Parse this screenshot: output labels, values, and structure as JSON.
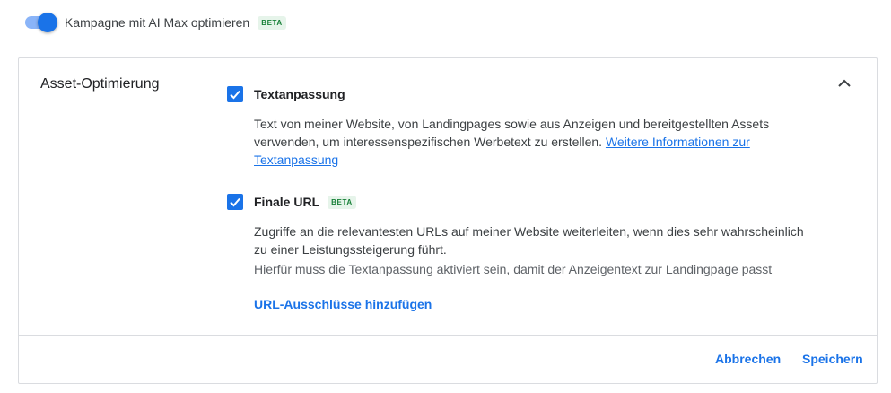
{
  "toggle": {
    "label": "Kampagne mit AI Max optimieren",
    "badge": "BETA",
    "on": true,
    "color": "#1a73e8"
  },
  "card": {
    "title": "Asset-Optimierung",
    "collapse_icon": "chevron-up-icon"
  },
  "options": {
    "text": {
      "title": "Textanpassung",
      "checked": true,
      "desc_line1": "Text von meiner Website, von Landingpages sowie aus Anzeigen und bereitgestellten Assets",
      "desc_line2": "verwenden, um interessenspezifischen Werbetext zu erstellen.",
      "link_line1": "Weitere Informationen zur",
      "link_line2": "Textanpassung"
    },
    "url": {
      "title": "Finale URL",
      "badge": "BETA",
      "checked": true,
      "desc_line1": "Zugriffe an die relevantesten URLs auf meiner Website weiterleiten, wenn dies sehr wahrscheinlich",
      "desc_line2": "zu einer Leistungssteigerung führt.",
      "note": "Hierfür muss die Textanpassung aktiviert sein, damit der Anzeigentext zur Landingpage passt",
      "action": "URL-Ausschlüsse hinzufügen"
    }
  },
  "footer": {
    "cancel": "Abbrechen",
    "save": "Speichern"
  },
  "colors": {
    "accent": "#1a73e8",
    "beta_text": "#188038",
    "beta_bg": "#e6f4ea"
  }
}
